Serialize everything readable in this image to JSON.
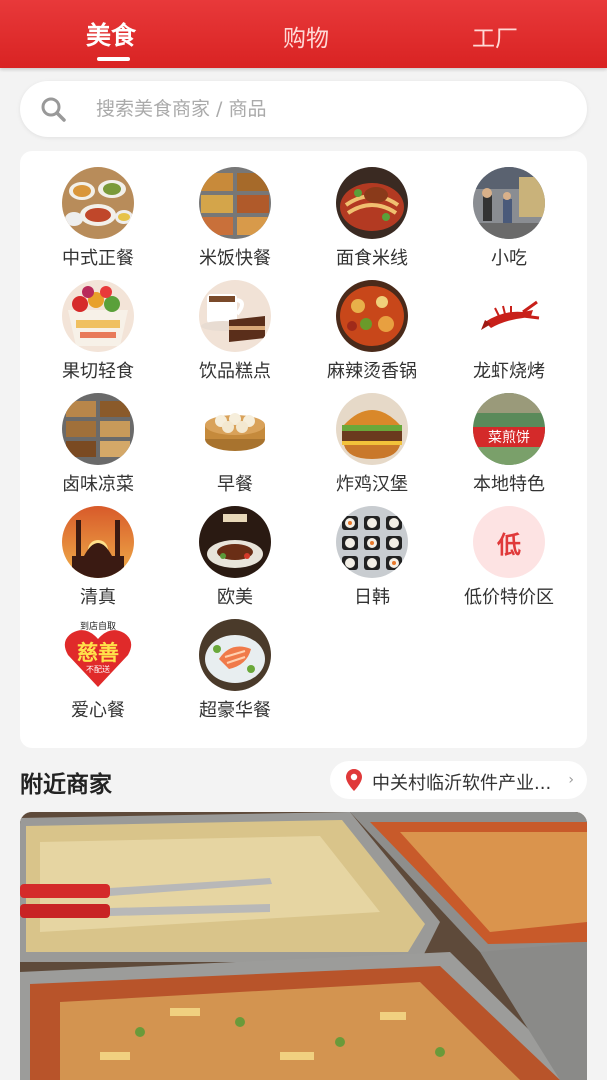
{
  "tabs": [
    {
      "label": "美食",
      "active": true
    },
    {
      "label": "购物",
      "active": false
    },
    {
      "label": "工厂",
      "active": false
    }
  ],
  "search": {
    "placeholder": "搜索美食商家 / 商品",
    "icon": "search-icon"
  },
  "categories": [
    {
      "label": "中式正餐",
      "icon": "chinese-banquet-image"
    },
    {
      "label": "米饭快餐",
      "icon": "fast-food-trays-image"
    },
    {
      "label": "面食米线",
      "icon": "noodles-image"
    },
    {
      "label": "小吃",
      "icon": "snack-market-image"
    },
    {
      "label": "果切轻食",
      "icon": "fruit-cup-image"
    },
    {
      "label": "饮品糕点",
      "icon": "coffee-cake-image"
    },
    {
      "label": "麻辣烫香锅",
      "icon": "spicy-pot-image"
    },
    {
      "label": "龙虾烧烤",
      "icon": "crayfish-image"
    },
    {
      "label": "卤味凉菜",
      "icon": "cold-dishes-image"
    },
    {
      "label": "早餐",
      "icon": "dumpling-steamer-image"
    },
    {
      "label": "炸鸡汉堡",
      "icon": "burger-image"
    },
    {
      "label": "本地特色",
      "icon": "local-shop-sign-image"
    },
    {
      "label": "清真",
      "icon": "mosque-image"
    },
    {
      "label": "欧美",
      "icon": "western-steak-image"
    },
    {
      "label": "日韩",
      "icon": "sushi-image"
    },
    {
      "label": "低价特价区",
      "icon": "low-price-badge",
      "badge_text": "低"
    },
    {
      "label": "爱心餐",
      "icon": "charity-heart-badge",
      "badge_top": "到店自取",
      "badge_main": "慈善",
      "badge_bottom": "不配送"
    },
    {
      "label": "超豪华餐",
      "icon": "salmon-plate-image"
    }
  ],
  "nearby": {
    "title": "附近商家",
    "location": "中关村临沂软件产业...",
    "chevron": "›"
  },
  "colors": {
    "brand_red": "#e02d2d",
    "background": "#f3f3f3"
  }
}
